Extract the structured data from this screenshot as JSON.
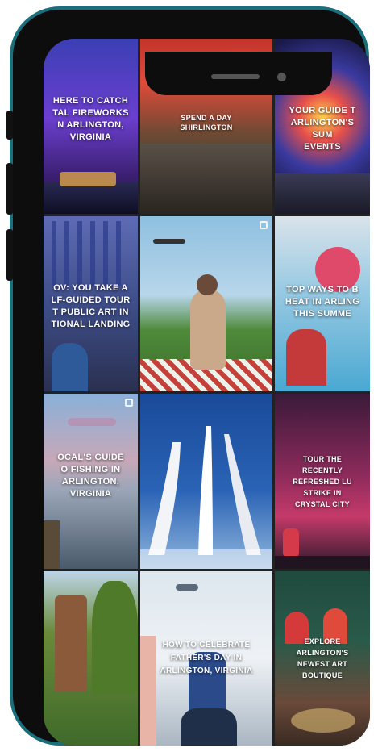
{
  "feed": {
    "tiles": [
      {
        "title": "HERE TO CATCH\nTAL FIREWORKS\nN ARLINGTON,\nVIRGINIA",
        "bg": "#4a2a9c"
      },
      {
        "title": "SPEND A DAY\nSHIRLINGTON",
        "bg": "#b8382c"
      },
      {
        "title": "YOUR GUIDE T\nARLINGTON'S SUM\nEVENTS",
        "bg": "#2b2a7a"
      },
      {
        "title": "OV: YOU TAKE A\nLF-GUIDED TOUR\nT PUBLIC ART IN\nTIONAL LANDING",
        "bg": "#4d5a8a"
      },
      {
        "title": "",
        "bg": "#7fb3d8"
      },
      {
        "title": "TOP WAYS TO B\nHEAT IN ARLING\nTHIS SUMME",
        "bg": "#6aa9c6"
      },
      {
        "title": "OCAL'S GUIDE\nO FISHING IN\nARLINGTON,\nVIRGINIA",
        "bg": "#8aa0b8"
      },
      {
        "title": "",
        "bg": "#1f4f9a"
      },
      {
        "title": "TOUR THE\nRECENTLY\nREFRESHED LU\nSTRIKE IN\nCRYSTAL CITY",
        "bg": "#5a1f44"
      },
      {
        "title": "",
        "bg": "#5c7a3a"
      },
      {
        "title": "HOW TO CELEBRATE\nFATHER'S DAY IN\nARLINGTON, VIRGINIA",
        "bg": "#c9d6e2"
      },
      {
        "title": "EXPLORE\nARLINGTON'S\nNEWEST ART\nBOUTIQUE",
        "bg": "#1f4a3e"
      }
    ]
  }
}
